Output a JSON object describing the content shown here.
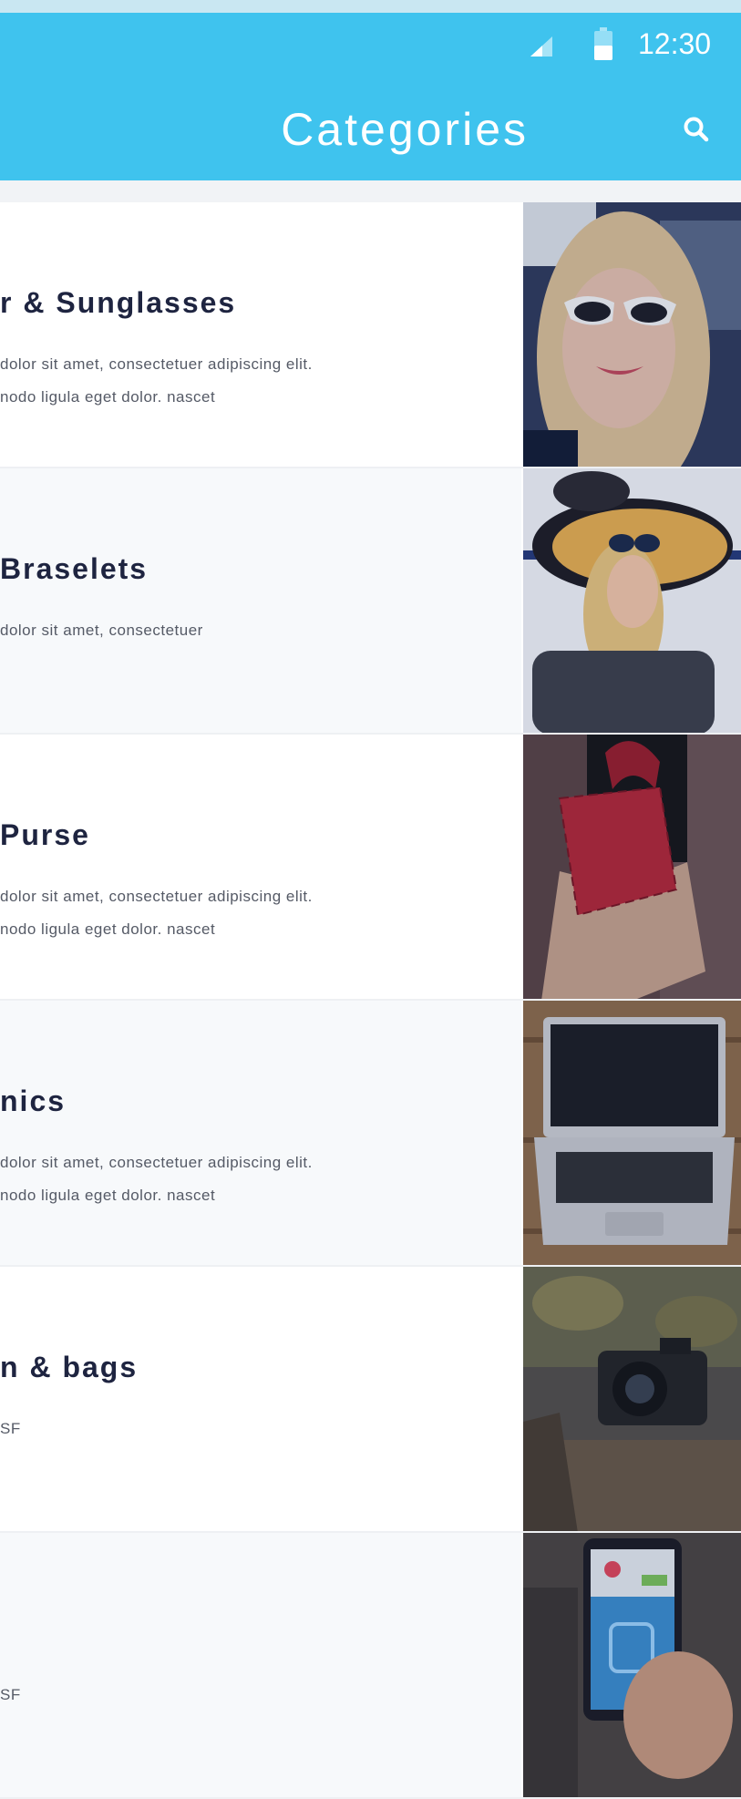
{
  "status": {
    "time": "12:30"
  },
  "header": {
    "title": "Categories"
  },
  "categories": [
    {
      "title": "r & Sunglasses",
      "description": " dolor sit amet, consectetuer adipiscing elit.\nnodo ligula eget dolor. nascet",
      "image": "woman-with-sunglasses"
    },
    {
      "title": "Braselets",
      "description": " dolor sit amet, consectetuer",
      "image": "woman-in-yellow-hat"
    },
    {
      "title": "Purse",
      "description": " dolor sit amet, consectetuer adipiscing elit.\nnodo ligula eget dolor. nascet",
      "image": "red-quilted-purse"
    },
    {
      "title": "nics",
      "description": " dolor sit amet, consectetuer adipiscing elit.\nnodo ligula eget dolor. nascet",
      "image": "laptop-on-wood"
    },
    {
      "title": "n & bags",
      "description": "SF",
      "image": "camera-on-log"
    },
    {
      "title": "",
      "description": "SF",
      "image": "phone-in-hand"
    }
  ],
  "colors": {
    "app_bar": "#3fc3ee",
    "title_text": "#1e2440"
  }
}
